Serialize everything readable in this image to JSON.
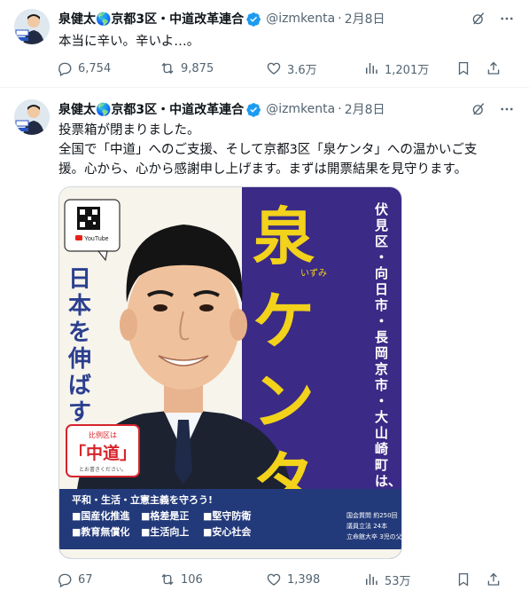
{
  "tweets": [
    {
      "author": "泉健太🌎京都3区・中道改革連合",
      "handle": "@izmkenta",
      "date": "2月8日",
      "text": "本当に辛い。辛いよ…。",
      "stats": {
        "replies": "6,754",
        "reposts": "9,875",
        "likes": "3.6万",
        "views": "1,201万"
      }
    },
    {
      "author": "泉健太🌎京都3区・中道改革連合",
      "handle": "@izmkenta",
      "date": "2月8日",
      "text_lines": [
        "投票箱が閉まりました。",
        "全国で「中道」へのご支援、そして京都3区「泉ケンタ」への温かいご支",
        "援。心から、心から感謝申し上げます。まずは開票結果を見守ります。"
      ],
      "stats": {
        "replies": "67",
        "reposts": "106",
        "likes": "1,398",
        "views": "53万"
      },
      "poster": {
        "name_big": "泉ケンタ",
        "furigana": "いずみ",
        "slogan": "日本を伸ばす!",
        "areas": "伏見区・向日市・長岡京市・大山崎町は、",
        "party_label": "比例区は",
        "party": "「中道」",
        "party_note": "とお書きください。",
        "youtube": "YouTube",
        "policy_title": "平和・生活・立憲主義を守ろう!",
        "policies": [
          "■国産化推進",
          "■格差是正",
          "■堅守防衛",
          "■教育無償化",
          "■生活向上",
          "■安心社会"
        ],
        "profile": [
          "国会質問 約250回",
          "議員立法 24本",
          "立命館大卒 3児の父"
        ]
      }
    }
  ],
  "colors": {
    "purple": "#3b2a86",
    "yellow": "#f2d21b",
    "navy": "#233a7a",
    "red": "#d6242b",
    "verified": "#1d9bf0"
  }
}
